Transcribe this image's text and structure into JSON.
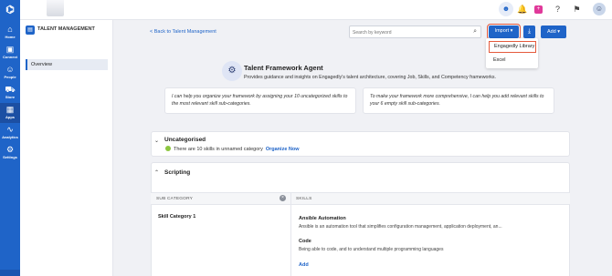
{
  "nav": {
    "items": [
      {
        "label": "Home",
        "icon": "home-icon"
      },
      {
        "label": "Connect",
        "icon": "connect-icon"
      },
      {
        "label": "People",
        "icon": "people-icon"
      },
      {
        "label": "Store",
        "icon": "store-icon"
      },
      {
        "label": "Apps",
        "icon": "apps-icon"
      },
      {
        "label": "Analytics",
        "icon": "analytics-icon"
      },
      {
        "label": "Settings",
        "icon": "settings-icon"
      }
    ],
    "active": "Apps"
  },
  "panel": {
    "title": "TALENT MANAGEMENT",
    "items": [
      {
        "label": "Overview"
      }
    ]
  },
  "header": {
    "back_label": "< Back to Talent Management",
    "search_placeholder": "Search by keyword",
    "import_label": "Import ▾",
    "add_label": "Add ▾",
    "import_menu": [
      "Engagedly Library",
      "Excel"
    ]
  },
  "agent": {
    "title": "Talent Framework Agent",
    "subtitle": "Provides guidance and insights on Engagedly's talent architecture, covering Job, Skills, and Competency frameworks."
  },
  "suggestions": [
    "I can help you organize your framework by assigning your 10 uncategorized skills to the most relevant skill sub-categories.",
    "To make your framework more comprehensive, I can help you add relevant skills to your 6 empty skill sub-categories."
  ],
  "uncategorised": {
    "title": "Uncategorised",
    "text": "There are   10 skills in unnamed category",
    "link": "Organize Now"
  },
  "scripting": {
    "title": "Scripting",
    "columns": [
      "SUB CATEGORY",
      "SKILLS"
    ],
    "category": "Skill Category 1",
    "skills": [
      {
        "name": "Ansible Automation",
        "desc": "Ansible is an automation tool that simplifies configuration management, application deployment, an..."
      },
      {
        "name": "Code",
        "desc": "Being able to code, and to understand multiple programming languages"
      }
    ],
    "add_label": "Add"
  },
  "colors": {
    "brand": "#1f64c8",
    "highlight": "#e55a3c",
    "status_dot": "#8cc63f"
  }
}
